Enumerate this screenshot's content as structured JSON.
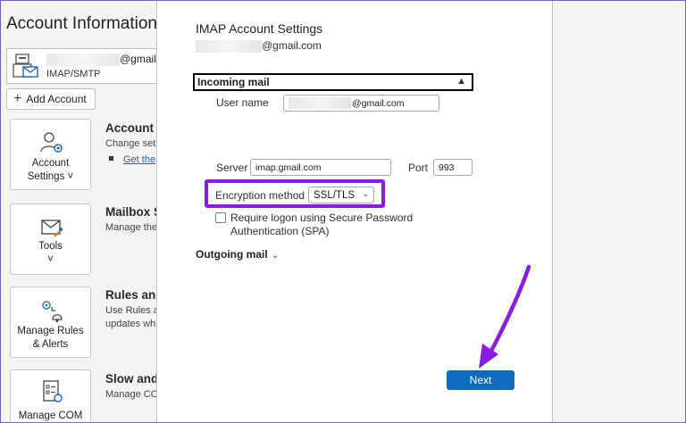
{
  "backstage": {
    "title": "Account Information",
    "account": {
      "email_suffix": "@gmail.c",
      "type": "IMAP/SMTP"
    },
    "add_account_label": "Add Account",
    "cards": [
      {
        "label1": "Account",
        "label2": "Settings ˅",
        "icon": "account-settings-icon"
      },
      {
        "label1": "Tools",
        "label2": "˅",
        "icon": "tools-icon"
      },
      {
        "label1": "Manage Rules",
        "label2": "& Alerts",
        "icon": "rules-alerts-icon"
      },
      {
        "label1": "Manage COM",
        "label2": "",
        "icon": "manage-com-icon"
      }
    ],
    "sections": [
      {
        "heading": "Account",
        "desc1": "Change set",
        "link": "Get the"
      },
      {
        "heading": "Mailbox S",
        "desc1": "Manage the"
      },
      {
        "heading": "Rules and",
        "desc1": "Use Rules a",
        "desc2": "updates wh"
      },
      {
        "heading": "Slow and",
        "desc1": "Manage CO"
      }
    ]
  },
  "dialog": {
    "title": "IMAP Account Settings",
    "email_suffix": "@gmail.com",
    "incoming": {
      "section_label": "Incoming mail",
      "user_name_label": "User name",
      "user_name_suffix": "@gmail.com",
      "server_label": "Server",
      "server_value": "imap.gmail.com",
      "port_label": "Port",
      "port_value": "993",
      "encryption_label": "Encryption method",
      "encryption_value": "SSL/TLS",
      "spa_label": "Require logon using Secure Password Authentication (SPA)",
      "spa_checked": false
    },
    "outgoing": {
      "section_label": "Outgoing mail"
    },
    "next_label": "Next"
  },
  "colors": {
    "highlight": "#8a1de0",
    "arrow": "#8a1de0",
    "primary_button": "#0f6cbd",
    "link": "#1a66c2"
  }
}
